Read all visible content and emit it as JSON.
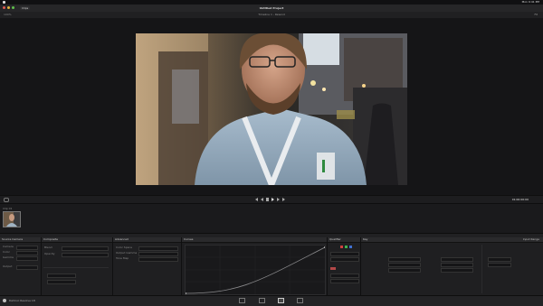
{
  "menubar": {
    "items": [
      "DaVinci Resolve",
      "File",
      "Edit",
      "Trim",
      "Timeline",
      "Clip",
      "Mark",
      "View",
      "Playback",
      "Fusion",
      "Color",
      "Fairlight",
      "Workspace",
      "Help"
    ],
    "status": "Mon 9:41 PM"
  },
  "title": {
    "project": "Untitled Project",
    "subtitle": "Edit Pictures",
    "left_button": "Clips"
  },
  "toolbar": {
    "center": "Timeline 1 - Rewind",
    "zoom": "100%",
    "right": "Fit"
  },
  "transport": {
    "timecode": "01:00:00:00"
  },
  "media": {
    "thumb_label": "Clip 01"
  },
  "panels": {
    "source_camera": {
      "title": "Source Camera",
      "rows": [
        "Camera",
        "Color",
        "Gamma",
        "Output"
      ]
    },
    "composite": {
      "title": "Composite",
      "rows": [
        "Blend",
        "Opacity"
      ]
    },
    "advanced": {
      "title": "Advanced",
      "rows": [
        "Color Space",
        "Output Gamma",
        "Tone Map"
      ]
    },
    "curves": {
      "title": "Curves",
      "labels": [
        "Edit",
        "Lum",
        "Sat"
      ]
    },
    "qualifier": {
      "title": "Qualifier"
    },
    "keys": {
      "title": "Key",
      "right": "Input Range"
    }
  },
  "bottom": {
    "app": "DaVinci Resolve 18",
    "pages": [
      "Media",
      "Cut",
      "Edit",
      "Fusion",
      "Color",
      "Fairlight",
      "Deliver"
    ]
  }
}
